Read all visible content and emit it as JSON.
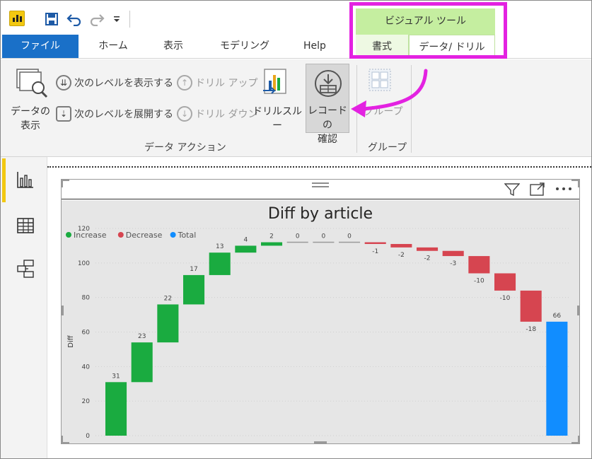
{
  "quick_access": {
    "app_icon": "power-bi-icon",
    "save_icon": "save-icon",
    "undo_icon": "undo-icon",
    "redo_icon": "redo-icon",
    "more_icon": "customize-dropdown-icon"
  },
  "tabs": [
    {
      "label": "ファイル"
    },
    {
      "label": "ホーム"
    },
    {
      "label": "表示"
    },
    {
      "label": "モデリング"
    },
    {
      "label": "Help"
    }
  ],
  "contextual": {
    "header": "ビジュアル ツール",
    "tabs": [
      {
        "label": "書式"
      },
      {
        "label": "データ/ ドリル"
      }
    ],
    "highlight_color": "#e322e1"
  },
  "ribbon": {
    "see_data": {
      "line1": "データの",
      "line2": "表示"
    },
    "drill_next_level": "次のレベルを表示する",
    "expand_next_level": "次のレベルを展開する",
    "drill_up": "ドリル アップ",
    "drill_down": "ドリル ダウン",
    "drillthrough": "ドリルスルー",
    "see_records": {
      "line1": "レコードの",
      "line2": "確認"
    },
    "group_btn": "グループ",
    "group_data_actions": "データ アクション",
    "group_groups": "グループ"
  },
  "left_nav": [
    {
      "icon": "report-view-icon",
      "active": true
    },
    {
      "icon": "data-view-icon",
      "active": false
    },
    {
      "icon": "model-view-icon",
      "active": false
    }
  ],
  "visual_header": {
    "filter_icon": "filter-icon",
    "focus_icon": "focus-mode-icon",
    "more_icon": "more-options-icon"
  },
  "chart_data": {
    "type": "waterfall",
    "title": "Diff by article",
    "ylabel": "Diff",
    "xlabel": "",
    "ylim": [
      0,
      120
    ],
    "yticks": [
      0,
      20,
      40,
      60,
      80,
      100,
      120
    ],
    "legend": [
      {
        "name": "Increase",
        "color": "#1aab40"
      },
      {
        "name": "Decrease",
        "color": "#d64550"
      },
      {
        "name": "Total",
        "color": "#118dff"
      }
    ],
    "legend_position": "top-left",
    "grid": true,
    "values": [
      31,
      23,
      22,
      17,
      13,
      4,
      2,
      0,
      0,
      0,
      -1,
      -2,
      -2,
      -3,
      -10,
      -10,
      -18
    ],
    "total": 66,
    "data_labels": [
      "31",
      "23",
      "22",
      "17",
      "13",
      "4",
      "2",
      "0",
      "0",
      "0",
      "-1",
      "-2",
      "-2",
      "-3",
      "-10",
      "-10",
      "-18",
      "66"
    ]
  }
}
